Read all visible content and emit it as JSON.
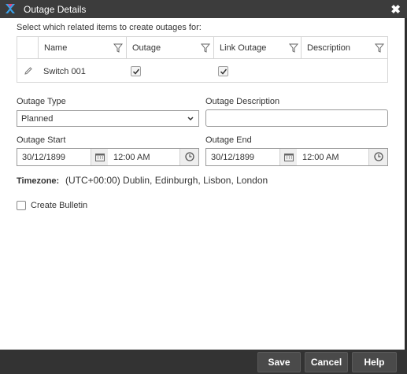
{
  "window": {
    "title": "Outage Details",
    "close_glyph": "✖",
    "logo_icon": "app-logo-icon"
  },
  "grid": {
    "caption": "Select which related items to create outages for:",
    "columns": [
      "Name",
      "Outage",
      "Link Outage",
      "Description"
    ],
    "rows": [
      {
        "name": "Switch 001",
        "outage": true,
        "link_outage": true,
        "description": ""
      }
    ]
  },
  "form": {
    "outage_type_label": "Outage Type",
    "outage_type_value": "Planned",
    "outage_description_label": "Outage Description",
    "outage_description_value": "",
    "outage_start_label": "Outage Start",
    "outage_start_date": "30/12/1899",
    "outage_start_time": "12:00 AM",
    "outage_end_label": "Outage End",
    "outage_end_date": "30/12/1899",
    "outage_end_time": "12:00 AM",
    "timezone_label": "Timezone:",
    "timezone_value": "(UTC+00:00) Dublin, Edinburgh, Lisbon, London",
    "create_bulletin_label": "Create Bulletin",
    "create_bulletin_checked": false
  },
  "footer": {
    "save_label": "Save",
    "cancel_label": "Cancel",
    "help_label": "Help"
  },
  "colors": {
    "titlebar": "#3c3c3c",
    "footer": "#333333",
    "logo_accent": "#3aa0e8",
    "logo_accent2": "#e8437a"
  }
}
